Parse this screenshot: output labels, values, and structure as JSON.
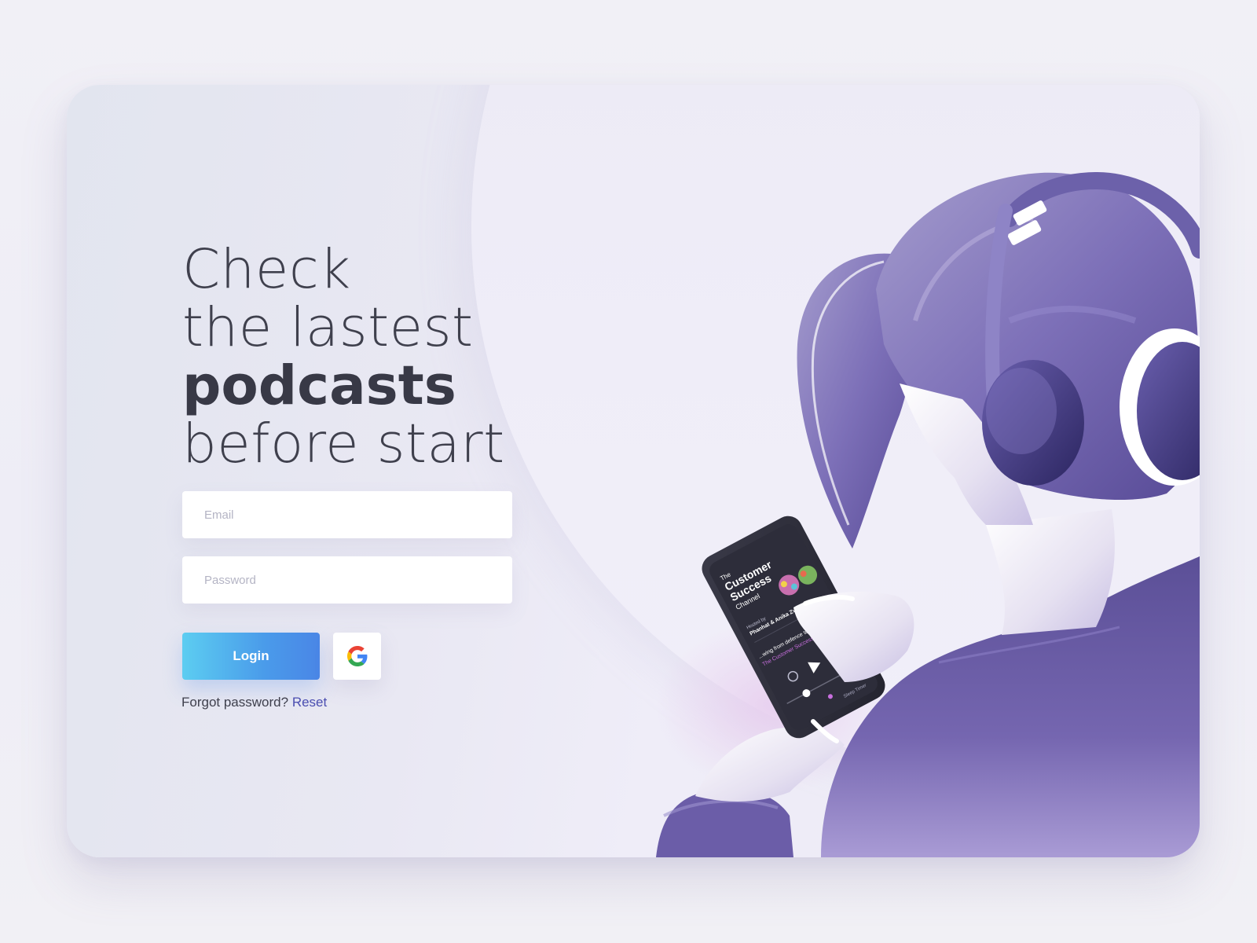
{
  "headline": {
    "line1": "Check",
    "line2": "the lastest",
    "line3_bold": "podcasts",
    "line4": "before start"
  },
  "form": {
    "email_placeholder": "Email",
    "email_value": "",
    "password_placeholder": "Password",
    "password_value": "",
    "login_label": "Login",
    "google_icon": "google-logo-icon"
  },
  "forgot": {
    "text": "Forgot password?",
    "link_label": "Reset"
  },
  "phone_screen": {
    "title_the": "The",
    "title_customer": "Customer",
    "title_success": "Success",
    "title_channel": "Channel",
    "hosted_by": "Hosted by",
    "hosts": "Phanhat & Anika Zvibe",
    "episode": "...wing from defence to offence in CS",
    "show": "The Customer Success Channel",
    "sleep_timer": "Sleep Timer"
  },
  "colors": {
    "accent_start": "#5ccdf1",
    "accent_end": "#4a86e6",
    "link": "#4a4db0",
    "headline": "#3e3f4c",
    "illustration_purple": "#6c5fa8"
  }
}
